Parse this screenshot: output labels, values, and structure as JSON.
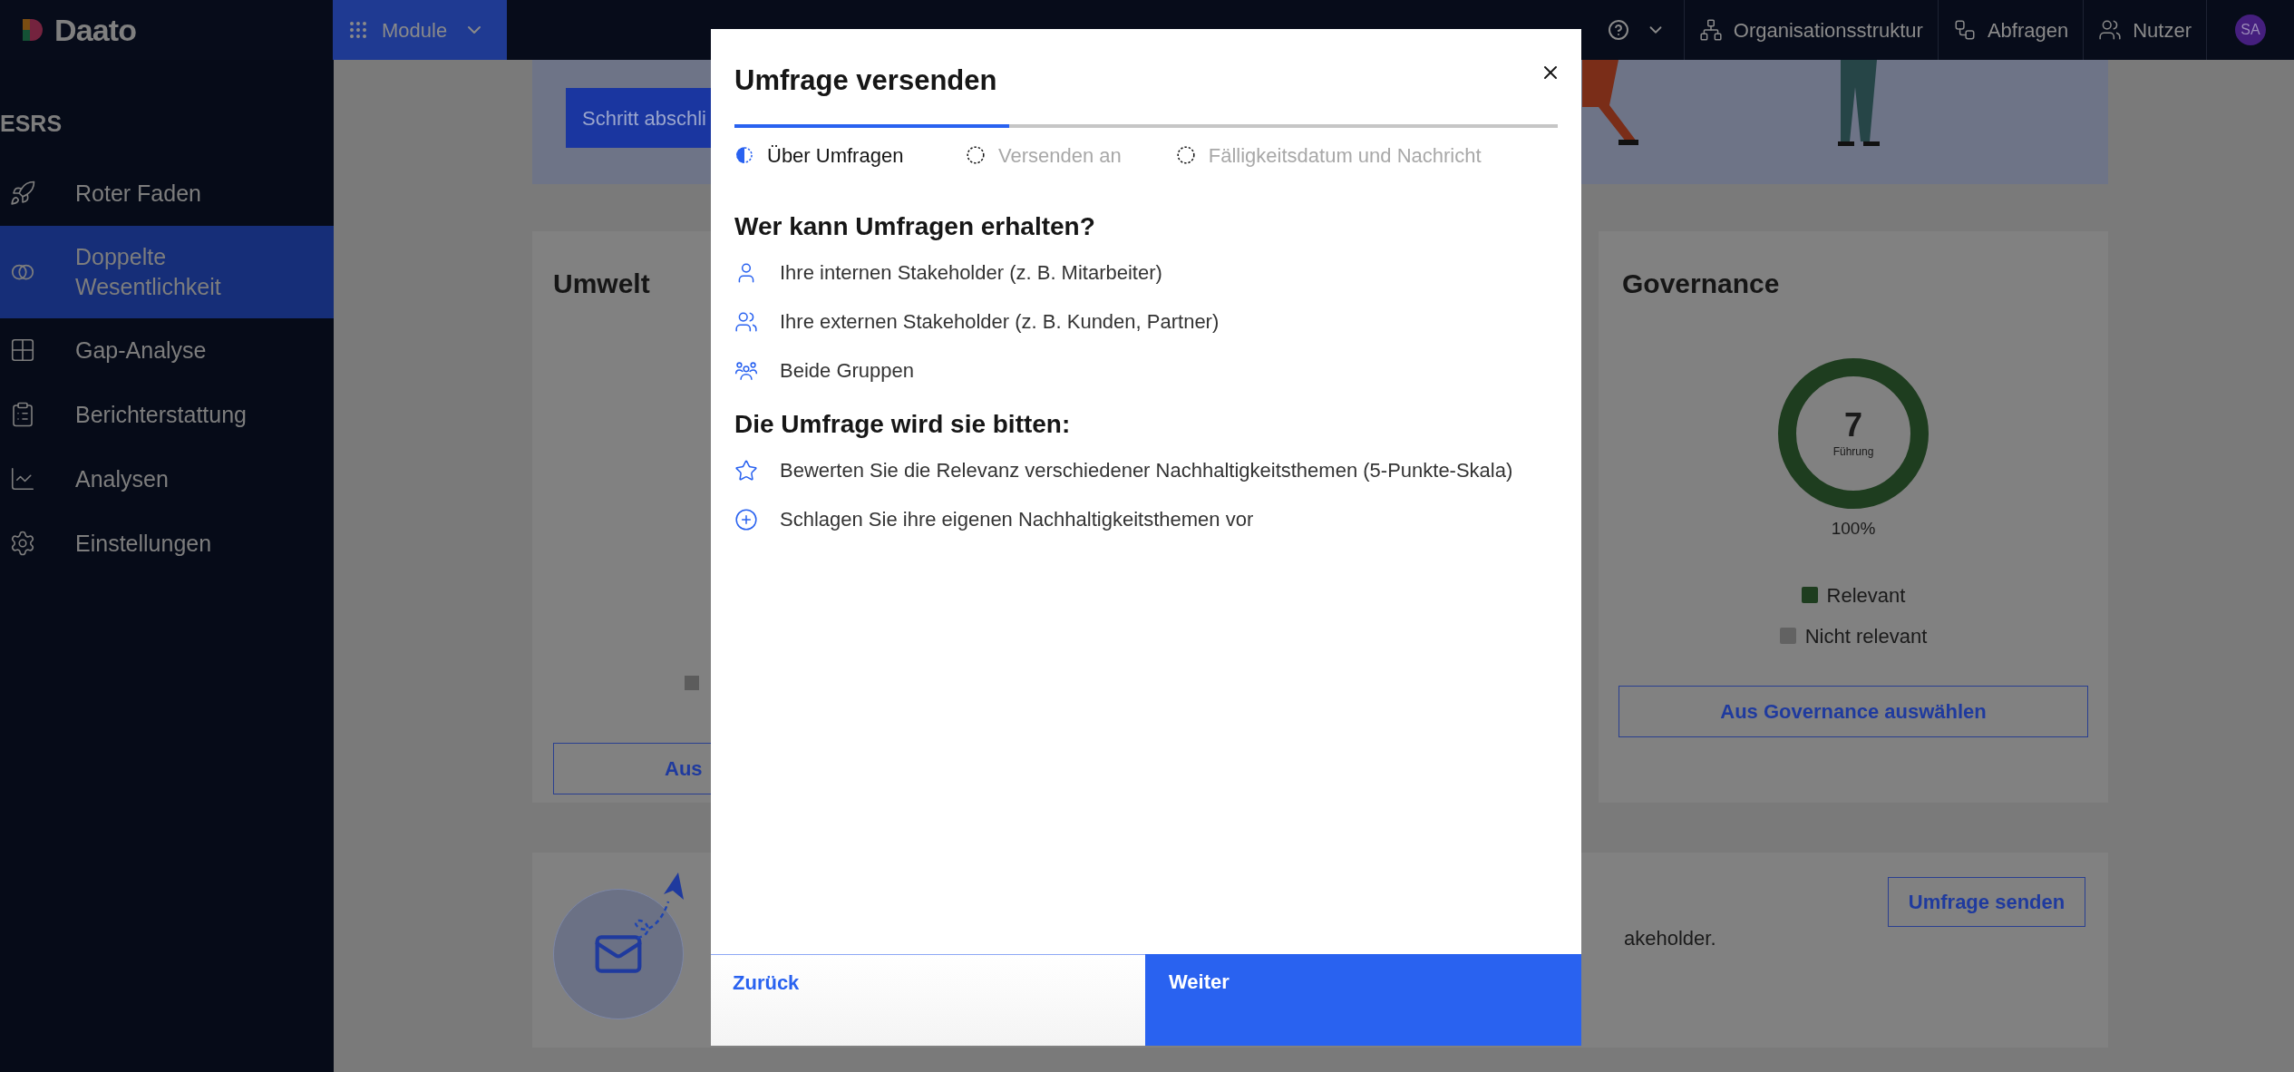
{
  "topbar": {
    "logo": "Daato",
    "module_button": "Module",
    "nav": [
      {
        "kind": "org",
        "label": "Organisationsstruktur"
      },
      {
        "kind": "flow",
        "label": "Abfragen"
      },
      {
        "kind": "users",
        "label": "Nutzer"
      }
    ],
    "avatar": "SA"
  },
  "sidebar": {
    "section": "ESRS",
    "items": [
      {
        "kind": "rocket",
        "label": "Roter Faden",
        "selected": false
      },
      {
        "kind": "circles",
        "label": "Doppelte Wesentlichkeit",
        "selected": true
      },
      {
        "kind": "grid",
        "label": "Gap-Analyse",
        "selected": false
      },
      {
        "kind": "clipboard",
        "label": "Berichterstattung",
        "selected": false
      },
      {
        "kind": "chart",
        "label": "Analysen",
        "selected": false
      },
      {
        "kind": "settings",
        "label": "Einstellungen",
        "selected": false
      }
    ]
  },
  "banner": {
    "button": "Schritt abschli"
  },
  "umwelt_card": {
    "title": "Umwelt",
    "legend_swatch": {
      "color": "#5c5c5c"
    },
    "button": "Aus"
  },
  "governance_card": {
    "title": "Governance",
    "count": "7",
    "caption": "Führung",
    "percent": "100%",
    "legend": [
      {
        "label": "Relevant",
        "color": "#1e3d1f"
      },
      {
        "label": "Nicht relevant",
        "color": "#626262"
      }
    ],
    "button": "Aus Governance auswählen"
  },
  "bottom_card": {
    "text": "akeholder.",
    "button": "Umfrage senden"
  },
  "modal": {
    "title": "Umfrage versenden",
    "steps": [
      {
        "label": "Über Umfragen",
        "selected": true
      },
      {
        "label": "Versenden an",
        "selected": false
      },
      {
        "label": "Fälligkeitsdatum und Nachricht",
        "selected": false
      }
    ],
    "sections": [
      {
        "heading": "Wer kann Umfragen erhalten?",
        "items": [
          {
            "kind": "person",
            "text": "Ihre internen Stakeholder (z. B. Mitarbeiter)"
          },
          {
            "kind": "pair",
            "text": "Ihre externen Stakeholder (z. B. Kunden, Partner)"
          },
          {
            "kind": "group",
            "text": "Beide Gruppen"
          }
        ]
      },
      {
        "heading": "Die Umfrage wird sie bitten:",
        "items": [
          {
            "kind": "star",
            "text": "Bewerten Sie die Relevanz verschiedener Nachhaltigkeitsthemen (5-Punkte-Skala)"
          },
          {
            "kind": "plus",
            "text": "Schlagen Sie ihre eigenen Nachhaltigkeitsthemen vor"
          }
        ]
      }
    ],
    "back_button": "Zurück",
    "next_button": "Weiter"
  }
}
